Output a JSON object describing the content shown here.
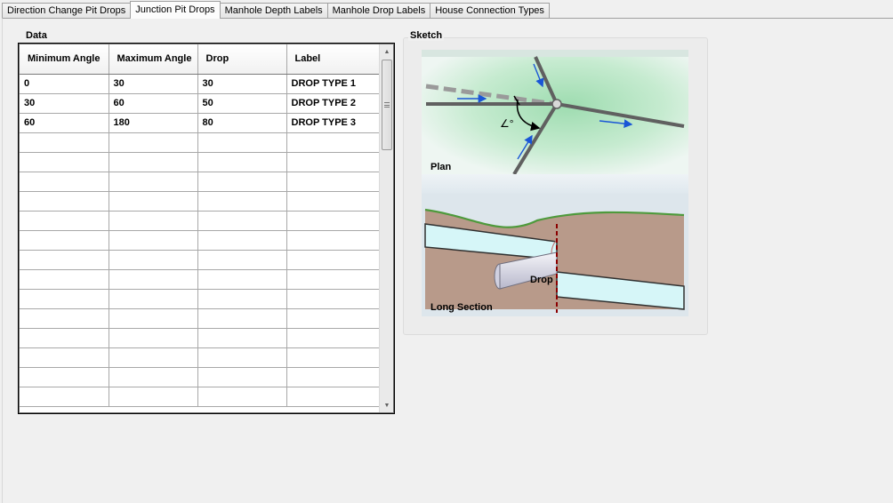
{
  "tabs": [
    {
      "label": "Direction Change Pit Drops",
      "active": false
    },
    {
      "label": "Junction Pit Drops",
      "active": true
    },
    {
      "label": "Manhole Depth Labels",
      "active": false
    },
    {
      "label": "Manhole Drop Labels",
      "active": false
    },
    {
      "label": "House Connection Types",
      "active": false
    }
  ],
  "data_group": {
    "title": "Data",
    "columns": [
      "Minimum Angle",
      "Maximum Angle",
      "Drop",
      "Label"
    ],
    "rows": [
      [
        "0",
        "30",
        "30",
        "DROP TYPE 1"
      ],
      [
        "30",
        "60",
        "50",
        "DROP TYPE 2"
      ],
      [
        "60",
        "180",
        "80",
        "DROP TYPE 3"
      ]
    ]
  },
  "sketch_group": {
    "title": "Sketch",
    "plan_label": "Plan",
    "angle_label": "∠°",
    "long_section_label": "Long Section",
    "drop_label": "Drop"
  },
  "colors": {
    "pipe": "#606060",
    "flow_arrow": "#1a56d6",
    "ground_line": "#4e9a3c",
    "soil": "#b89a8a",
    "water": "#d6f6f8",
    "drop_marker": "#8b0000"
  }
}
